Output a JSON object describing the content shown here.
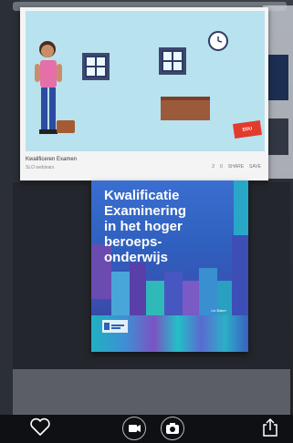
{
  "video_card": {
    "title": "Kwalificeren Examen",
    "channel": "SLO webinars",
    "likes": "2",
    "dislikes": "0",
    "share": "SHARE",
    "save": "SAVE"
  },
  "book": {
    "title_line1": "Kwalificatie",
    "title_line2": "Examinering",
    "title_line3": "in het hoger",
    "title_line4": "beroeps-",
    "title_line5": "onderwijs",
    "author": "Liz Baker"
  },
  "scene": {
    "badge_text": "EDU"
  },
  "controls": {
    "favorite_icon": "heart-icon",
    "video_icon": "video-camera-icon",
    "photo_icon": "camera-icon",
    "share_icon": "share-icon"
  },
  "colors": {
    "book_blue": "#2b62b8",
    "sky": "#b8e2ee"
  }
}
